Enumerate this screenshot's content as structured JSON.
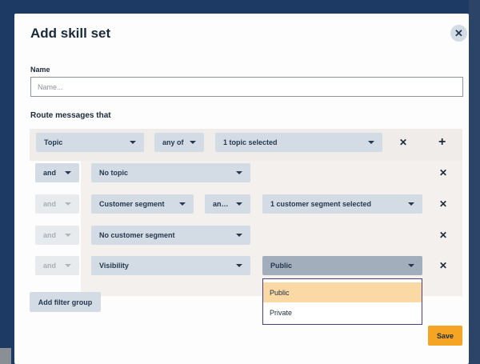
{
  "dialog": {
    "title": "Add skill set",
    "close_icon": "close-icon",
    "name_label": "Name",
    "name_placeholder": "Name...",
    "name_value": "",
    "route_label": "Route messages that"
  },
  "rule": {
    "field": "Topic",
    "operator": "any of",
    "value": "1 topic selected",
    "remove_icon": "x-icon",
    "add_icon": "plus-icon"
  },
  "filters": [
    {
      "conjunction": "and",
      "field": "No topic"
    },
    {
      "conjunction": "and",
      "field": "Customer segment",
      "operator": "an…",
      "value": "1 customer segment selected"
    },
    {
      "conjunction": "and",
      "field": "No customer segment"
    },
    {
      "conjunction": "and",
      "field": "Visibility",
      "value": "Public"
    }
  ],
  "visibility_menu": {
    "options": [
      "Public",
      "Private"
    ],
    "highlighted": "Public"
  },
  "buttons": {
    "add_filter_group": "Add filter group",
    "save": "Save"
  },
  "colors": {
    "backdrop": "#1c3a63",
    "dropdown": "#d3dbe5",
    "save": "#f5a423",
    "highlight": "#fbd9a5"
  }
}
